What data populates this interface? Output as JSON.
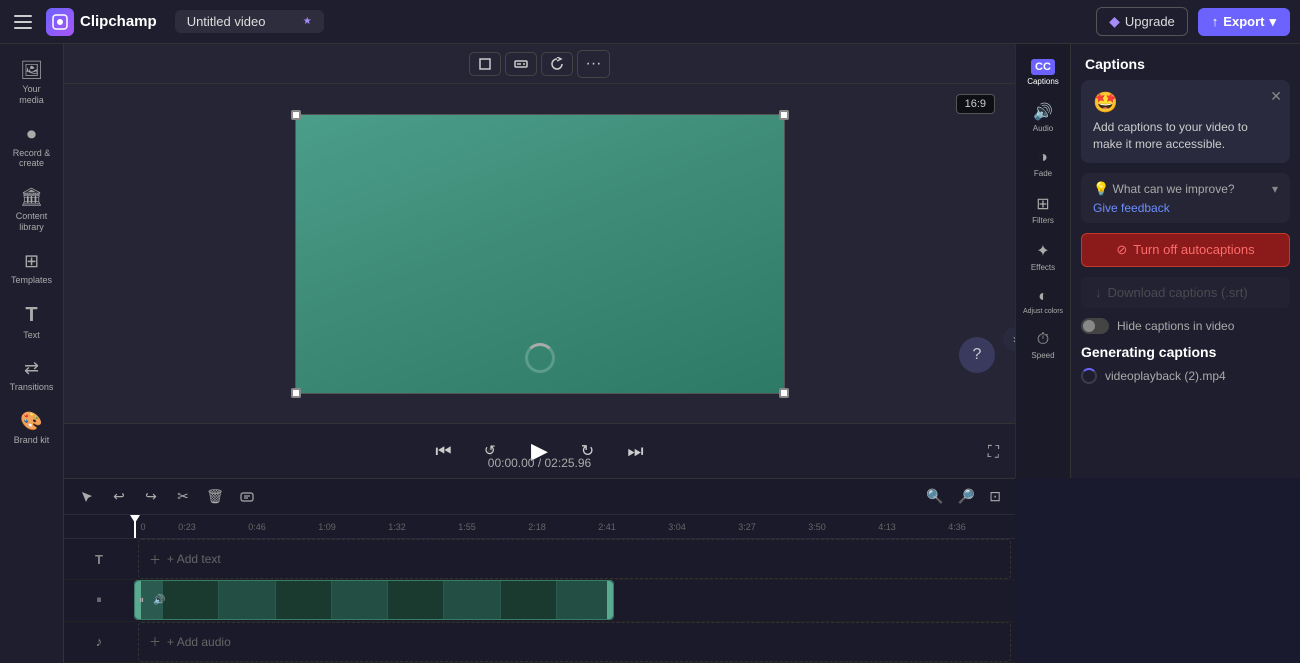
{
  "app": {
    "name": "Clipchamp",
    "title": "Untitled video"
  },
  "topbar": {
    "upgrade_label": "Upgrade",
    "export_label": "Export",
    "aspect_ratio": "16:9"
  },
  "left_sidebar": {
    "items": [
      {
        "id": "your-media",
        "label": "Your media",
        "icon": "🖼"
      },
      {
        "id": "record-create",
        "label": "Record &\ncreate",
        "icon": "⏺"
      },
      {
        "id": "content-library",
        "label": "Content\nlibrary",
        "icon": "🏛"
      },
      {
        "id": "templates",
        "label": "Templates",
        "icon": "⊞"
      },
      {
        "id": "text",
        "label": "Text",
        "icon": "T"
      },
      {
        "id": "transitions",
        "label": "Transitions",
        "icon": "⇄"
      },
      {
        "id": "brand-kit",
        "label": "Brand kit",
        "icon": "🎨"
      }
    ]
  },
  "right_panel": {
    "title": "Captions",
    "promo": {
      "emoji": "🤩",
      "text": "Add captions to your video to make it more accessible."
    },
    "feedback": {
      "question": "What can we improve?",
      "link": "Give feedback"
    },
    "turn_off_btn": "Turn off autocaptions",
    "download_btn": "Download captions (.srt)",
    "toggle_label": "Hide captions in video",
    "generating_label": "Generating captions",
    "generating_file": "videoplayback (2).mp4"
  },
  "right_icons": [
    {
      "id": "captions",
      "label": "Captions",
      "icon": "CC",
      "active": true
    },
    {
      "id": "audio",
      "label": "Audio",
      "icon": "♪"
    },
    {
      "id": "fade",
      "label": "Fade",
      "icon": "◑"
    },
    {
      "id": "filters",
      "label": "Filters",
      "icon": "⊞"
    },
    {
      "id": "effects",
      "label": "Effects",
      "icon": "✦"
    },
    {
      "id": "adjust-colors",
      "label": "Adjust\ncolors",
      "icon": "◐"
    },
    {
      "id": "speed",
      "label": "Speed",
      "icon": "⏱"
    }
  ],
  "timeline": {
    "time_current": "00:00.00",
    "time_total": "02:25.96",
    "ruler_marks": [
      "0",
      "0:23",
      "0:46",
      "1:09",
      "1:32",
      "1:55",
      "2:18",
      "2:41",
      "3:04",
      "3:27",
      "3:50",
      "4:13",
      "4:36"
    ],
    "add_text_label": "+ Add text",
    "add_audio_label": "+ Add audio"
  },
  "playback": {
    "skip_back_icon": "⏮",
    "rewind_icon": "↩",
    "play_icon": "▶",
    "fast_forward_icon": "↪",
    "skip_forward_icon": "⏭",
    "expand_icon": "⛶"
  }
}
